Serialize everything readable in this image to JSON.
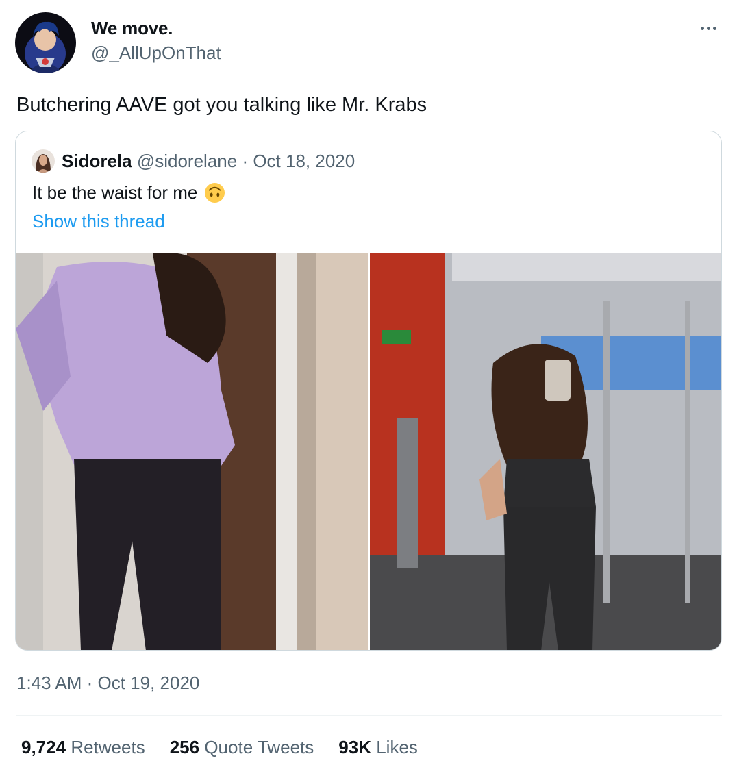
{
  "tweet": {
    "display_name": "We move.",
    "handle": "@_AllUpOnThat",
    "text": "Butchering AAVE got you talking like Mr. Krabs",
    "timestamp": "1:43 AM · Oct 19, 2020"
  },
  "quote": {
    "name": "Sidorela",
    "handle": "@sidorelane",
    "date": "· Oct 18, 2020",
    "text": "It be the waist for me",
    "emoji": "upside-down-face",
    "show_thread": "Show this thread"
  },
  "stats": {
    "retweets_count": "9,724",
    "retweets_label": "Retweets",
    "quotes_count": "256",
    "quotes_label": "Quote Tweets",
    "likes_count": "93K",
    "likes_label": "Likes"
  },
  "colors": {
    "text": "#0f1419",
    "secondary": "#536471",
    "link": "#1d9bf0",
    "border": "#cfd9de"
  }
}
